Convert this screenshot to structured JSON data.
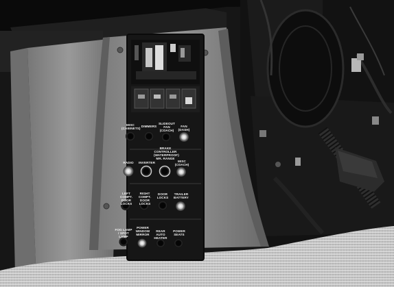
{
  "panel": {
    "row1": [
      "MISC (CABINETS)",
      "DIMMERS",
      "SLIDEOUT FAN (COACH)",
      "FAN (DASH)"
    ],
    "row2": [
      "RADIO",
      "INVERTER",
      "BRAKE CONTROLLER (WATERPROOF)\nMR. RANGE",
      "MISC (COACH)"
    ],
    "row3": [
      "LEFT COMPT. DOOR LOCKS",
      "RIGHT COMPT. DOOR LOCKS",
      "DOOR LOCKS",
      "TRAILER BATTERY"
    ],
    "row4": [
      "FOG LAMP / SPOT LAMP",
      "POWER WINDOW MIRROR",
      "REAR AUTO HEATER",
      "POWER SEATS"
    ]
  },
  "colors": {
    "console": "#8c8c8c",
    "panel": "#151515",
    "carpet": "#c9c9c9"
  }
}
